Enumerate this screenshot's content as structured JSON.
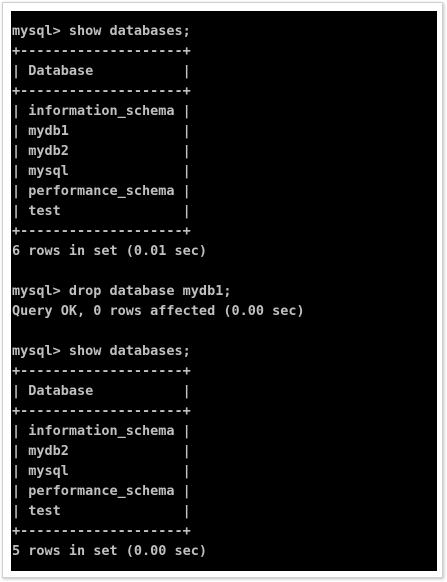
{
  "console": {
    "lines": [
      "mysql> show databases;",
      "+--------------------+",
      "| Database           |",
      "+--------------------+",
      "| information_schema |",
      "| mydb1              |",
      "| mydb2              |",
      "| mysql              |",
      "| performance_schema |",
      "| test               |",
      "+--------------------+",
      "6 rows in set (0.01 sec)",
      "",
      "mysql> drop database mydb1;",
      "Query OK, 0 rows affected (0.00 sec)",
      "",
      "mysql> show databases;",
      "+--------------------+",
      "| Database           |",
      "+--------------------+",
      "| information_schema |",
      "| mydb2              |",
      "| mysql              |",
      "| performance_schema |",
      "| test               |",
      "+--------------------+",
      "5 rows in set (0.00 sec)"
    ]
  }
}
